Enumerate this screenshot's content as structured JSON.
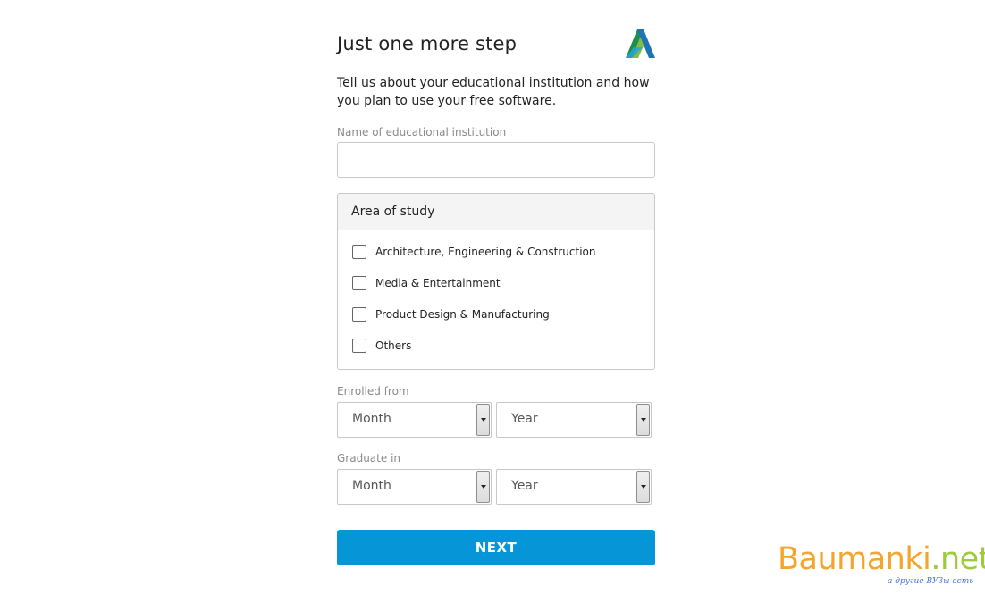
{
  "heading": {
    "title": "Just one more step",
    "subtitle": "Tell us about your educational institution and how you plan to use your free software."
  },
  "institution": {
    "label": "Name of educational institution",
    "value": "",
    "placeholder": ""
  },
  "area_of_study": {
    "title": "Area of study",
    "options": [
      {
        "label": "Architecture, Engineering & Construction",
        "checked": false
      },
      {
        "label": "Media & Entertainment",
        "checked": false
      },
      {
        "label": "Product Design & Manufacturing",
        "checked": false
      },
      {
        "label": "Others",
        "checked": false
      }
    ]
  },
  "enrolled_from": {
    "label": "Enrolled from",
    "month": "Month",
    "year": "Year"
  },
  "graduate_in": {
    "label": "Graduate in",
    "month": "Month",
    "year": "Year"
  },
  "next_button": "NEXT",
  "watermark": {
    "main": "Baumanki",
    "suffix": ".net",
    "tagline": "а другие ВУЗы есть"
  },
  "colors": {
    "accent": "#0696d7",
    "logo_blue": "#1f73b7",
    "logo_green": "#87bc40"
  }
}
